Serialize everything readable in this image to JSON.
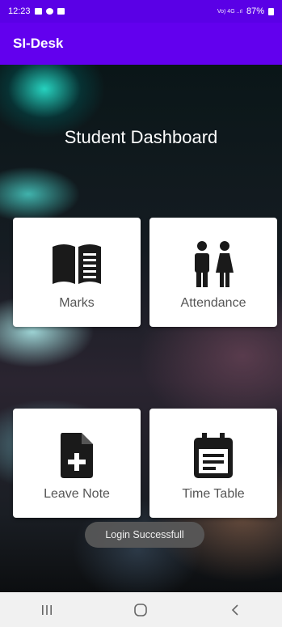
{
  "status_bar": {
    "time": "12:23",
    "signal_text": "Vo)) 4G LTE1",
    "battery": "87%"
  },
  "app_bar": {
    "title": "SI-Desk"
  },
  "dashboard": {
    "title": "Student Dashboard",
    "cards": [
      {
        "label": "Marks",
        "icon": "book-icon"
      },
      {
        "label": "Attendance",
        "icon": "people-icon"
      },
      {
        "label": "Leave Note",
        "icon": "note-add-icon"
      },
      {
        "label": "Time Table",
        "icon": "calendar-icon"
      }
    ]
  },
  "toast": {
    "text": "Login Successfull"
  },
  "nav_bar": {
    "buttons": [
      "recent-apps",
      "home",
      "back"
    ]
  },
  "colors": {
    "status_bar": "#5a00e6",
    "app_bar": "#6200ee",
    "card": "#ffffff",
    "nav_bar": "#f1f1f1"
  }
}
